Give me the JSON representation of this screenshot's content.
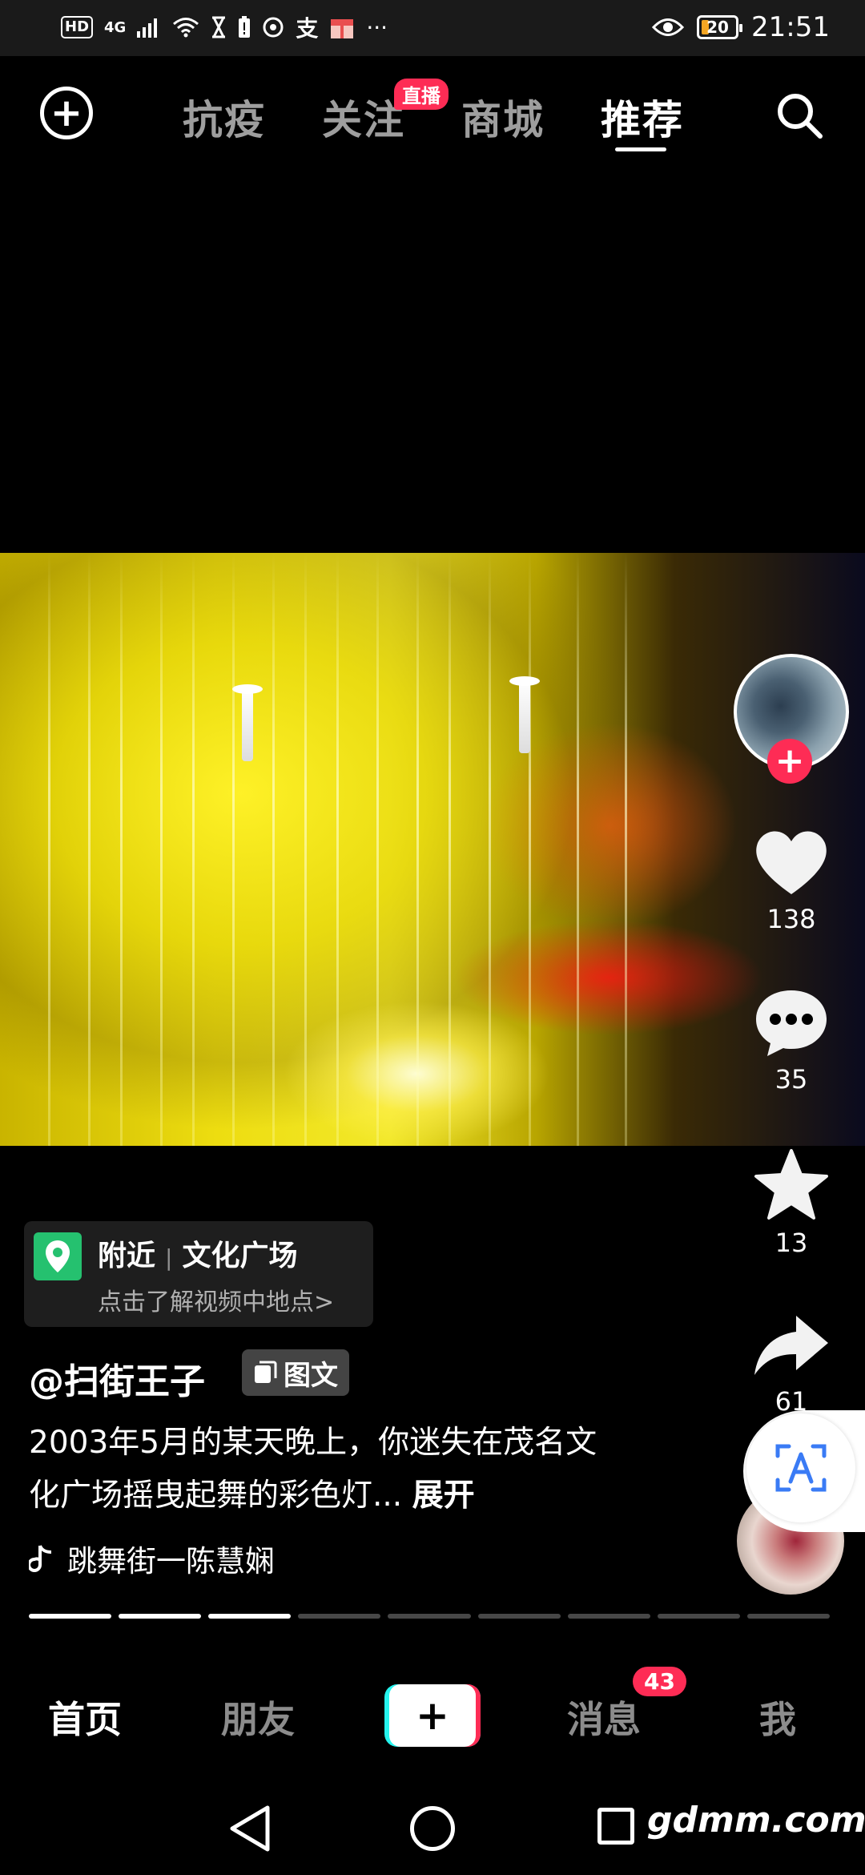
{
  "status_bar": {
    "hd": "HD",
    "network": "4G",
    "battery": "20",
    "time": "21:51"
  },
  "top_tabs": [
    {
      "label": "抗疫"
    },
    {
      "label": "关注"
    },
    {
      "label": "商城"
    },
    {
      "label": "推荐"
    }
  ],
  "live_badge": "直播",
  "rail": {
    "likes": "138",
    "comments": "35",
    "favorites": "13",
    "shares": "61"
  },
  "location": {
    "nearby": "附近",
    "place": "文化广场",
    "subtitle": "点击了解视频中地点>"
  },
  "author": "@扫街王子",
  "tag": "图文",
  "caption": {
    "text": "2003年5月的某天晚上，你迷失在茂名文化广场摇曳起舞的彩色灯...",
    "expand": "展开"
  },
  "music": "跳舞街一陈慧娴",
  "progress": {
    "total": 9,
    "done": 3
  },
  "bottom_tabs": {
    "home": "首页",
    "friends": "朋友",
    "messages": "消息",
    "me": "我",
    "messages_badge": "43"
  },
  "watermark": "gdmm.com",
  "colors": {
    "accent": "#fe2c55",
    "teal": "#25f4ee",
    "location_green": "#25c16f"
  }
}
